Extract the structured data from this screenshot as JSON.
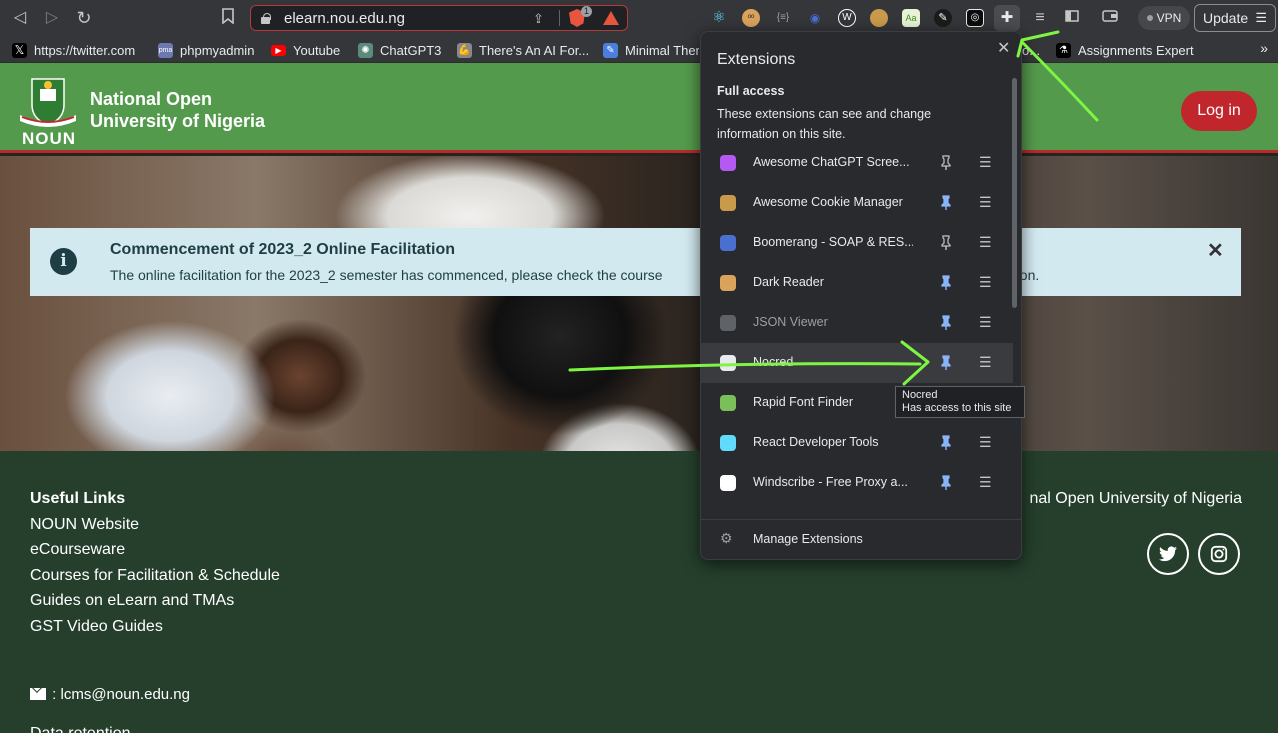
{
  "browser": {
    "url": "elearn.nou.edu.ng",
    "brave_badge_count": "1",
    "vpn_label": "VPN",
    "update_label": "Update",
    "toolbar_extensions": [
      {
        "icon": "react-icon",
        "color": "#61dafb"
      },
      {
        "icon": "dark-reader-icon",
        "color": "#d9a35b"
      },
      {
        "icon": "json-viewer-icon",
        "color": "#9aa0a6"
      },
      {
        "icon": "boomerang-icon",
        "color": "#4a6fd1"
      },
      {
        "icon": "windscribe-icon",
        "color": "#ffffff"
      },
      {
        "icon": "cookie-icon",
        "color": "#c99a4a"
      },
      {
        "icon": "font-finder-icon",
        "color": "#7bbf5a"
      },
      {
        "icon": "pen-icon",
        "color": "#e8eaed"
      },
      {
        "icon": "nocred-icon",
        "color": "#e8eaed"
      }
    ],
    "bookmarks": [
      {
        "label": "https://twitter.com",
        "icon": "x-logo-icon",
        "color": "#000000"
      },
      {
        "label": "phpmyadmin",
        "icon": "phpmyadmin-icon",
        "color": "#6c78af"
      },
      {
        "label": "Youtube",
        "icon": "youtube-icon",
        "color": "#ff0000"
      },
      {
        "label": "ChatGPT3",
        "icon": "chatgpt-icon",
        "color": "#5a8a7a"
      },
      {
        "label": "There's An AI For...",
        "icon": "arm-icon",
        "color": "#888888"
      },
      {
        "label": "Minimal Ther",
        "icon": "feather-icon",
        "color": "#4a7fe0"
      },
      {
        "label": "o...",
        "icon": "",
        "color": ""
      },
      {
        "label": "Assignments Expert",
        "icon": "microscope-icon",
        "color": "#000000"
      }
    ]
  },
  "site": {
    "brand_line1": "National Open",
    "brand_line2": "University of Nigeria",
    "logo_text": "NOUN",
    "login_label": "Log in",
    "alert_title": "Commencement of 2023_2 Online Facilitation",
    "alert_body": "The online facilitation for the 2023_2 semester has commenced, please check the course",
    "alert_body_tail": "ation.",
    "footer": {
      "heading": "Useful Links",
      "links": [
        "NOUN Website",
        "eCourseware",
        "Courses for Facilitation & Schedule",
        "Guides on eLearn and TMAs",
        "GST Video Guides"
      ],
      "email": ": lcms@noun.edu.ng",
      "cut_text": "Data retention",
      "copyright": "nal Open University of Nigeria"
    }
  },
  "extensions_popup": {
    "title": "Extensions",
    "section": "Full access",
    "description": "These extensions can see and change information on this site.",
    "items": [
      {
        "name": "Awesome ChatGPT Scree...",
        "icon": "chatgpt-screenshot-icon",
        "color": "#b45af2",
        "pinned": false
      },
      {
        "name": "Awesome Cookie Manager",
        "icon": "cookie-icon",
        "color": "#c99a4a",
        "pinned": true
      },
      {
        "name": "Boomerang - SOAP & RES...",
        "icon": "boomerang-icon",
        "color": "#4a6fd1",
        "pinned": false
      },
      {
        "name": "Dark Reader",
        "icon": "dark-reader-icon",
        "color": "#d9a35b",
        "pinned": true
      },
      {
        "name": "JSON Viewer",
        "icon": "json-viewer-icon",
        "color": "#5f6368",
        "pinned": true
      },
      {
        "name": "Nocred",
        "icon": "nocred-icon",
        "color": "#e8eaed",
        "pinned": true
      },
      {
        "name": "Rapid Font Finder",
        "icon": "font-finder-icon",
        "color": "#7bbf5a",
        "pinned": true
      },
      {
        "name": "React Developer Tools",
        "icon": "react-icon",
        "color": "#61dafb",
        "pinned": true
      },
      {
        "name": "Windscribe - Free Proxy a...",
        "icon": "windscribe-icon",
        "color": "#ffffff",
        "pinned": true
      }
    ],
    "manage_label": "Manage Extensions",
    "tooltip_title": "Nocred",
    "tooltip_body": "Has access to this site"
  },
  "colors": {
    "header_green": "#549a4c",
    "footer_green": "#253f2c",
    "login_red": "#c2262d",
    "alert_bg": "#d2e9ef",
    "annotation_green": "#7df542"
  }
}
